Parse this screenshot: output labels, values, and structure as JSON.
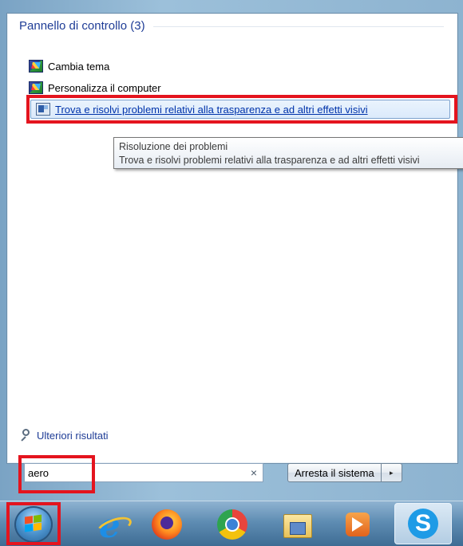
{
  "results": {
    "group_title": "Pannello di controllo (3)",
    "items": [
      {
        "label": "Cambia tema",
        "icon": "theme-icon"
      },
      {
        "label": "Personalizza il computer",
        "icon": "theme-icon"
      },
      {
        "label": "Trova e risolvi problemi relativi alla trasparenza e ad altri effetti visivi",
        "icon": "troubleshoot-icon"
      }
    ]
  },
  "tooltip": {
    "title": "Risoluzione dei problemi",
    "description": "Trova e risolvi problemi relativi alla trasparenza e ad altri effetti visivi"
  },
  "more_results": "Ulteriori risultati",
  "search": {
    "value": "aero",
    "clear_symbol": "×"
  },
  "shutdown": {
    "label": "Arresta il sistema",
    "arrow": "▸"
  },
  "taskbar": {
    "icons": [
      "start-orb",
      "internet-explorer-icon",
      "firefox-icon",
      "chrome-icon",
      "file-explorer-icon",
      "media-player-icon",
      "skype-icon"
    ],
    "skype_letter": "S",
    "ie_letter": "e"
  },
  "highlight_color": "#e4141e"
}
